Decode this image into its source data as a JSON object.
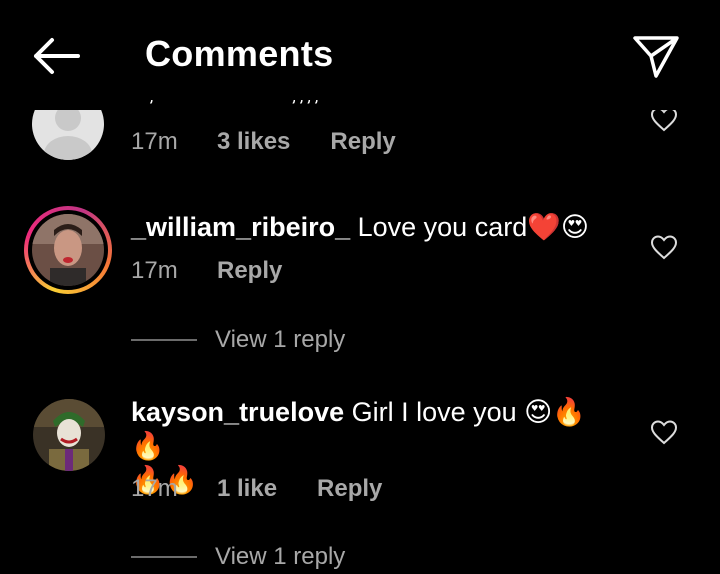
{
  "header": {
    "title": "Comments"
  },
  "comments": [
    {
      "username": "",
      "text": "",
      "time": "17m",
      "likes": "3 likes",
      "reply": "Reply"
    },
    {
      "username": "_william_ribeiro_",
      "text": " Love you card",
      "emojis": "❤️😍",
      "time": "17m",
      "reply": "Reply",
      "view_replies": "View 1 reply"
    },
    {
      "username": "kayson_truelove",
      "text": " Girl I love you ",
      "emojis_line1": "😍🔥🔥",
      "emojis_line2": "🔥🔥",
      "time": "17m",
      "likes": "1 like",
      "reply": "Reply",
      "view_replies": "View 1 reply"
    }
  ],
  "icons": {
    "back": "arrow-left-icon",
    "share": "paper-plane-icon",
    "like": "heart-outline-icon"
  },
  "colors": {
    "background": "#000000",
    "secondary_text": "#a8a8a8",
    "story_ring": "#ee2a7b"
  }
}
